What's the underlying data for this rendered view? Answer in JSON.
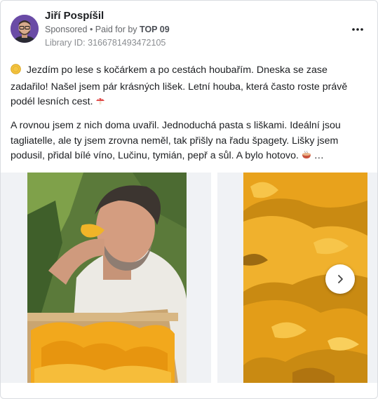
{
  "post": {
    "author": "Jiří Pospíšil",
    "sponsored_label": "Sponsored",
    "paid_for_prefix": " • Paid for by ",
    "paid_for_by": "TOP 09",
    "library_id": "Library ID: 3166781493472105",
    "more_icon": "three-dots-icon",
    "paragraph1": "Jezdím po lese s kočárkem a po cestách houbařím. Dneska se zase zadařilo! Našel jsem pár krásných lišek. Letní houba, která často roste právě podél lesních cest.",
    "paragraph2": "A rovnou jsem z nich doma uvařil. Jednoduchá pasta s liškami. Ideální jsou tagliatelle, ale ty jsem zrovna neměl, tak přišly na řadu špagety. Lišky jsem podusil, přidal bílé víno, Lučinu, tymián, pepř a sůl. A bylo hotovo.",
    "ellipsis": " …"
  },
  "carousel": {
    "slides": [
      {
        "image": "man-smelling-chanterelles-photo"
      },
      {
        "image": "pile-of-chanterelles-photo"
      }
    ],
    "next_icon": "chevron-right-icon"
  },
  "colors": {
    "accent_mushroom": "#e8a21c",
    "text": "#1c1e21",
    "muted": "#65676b"
  }
}
